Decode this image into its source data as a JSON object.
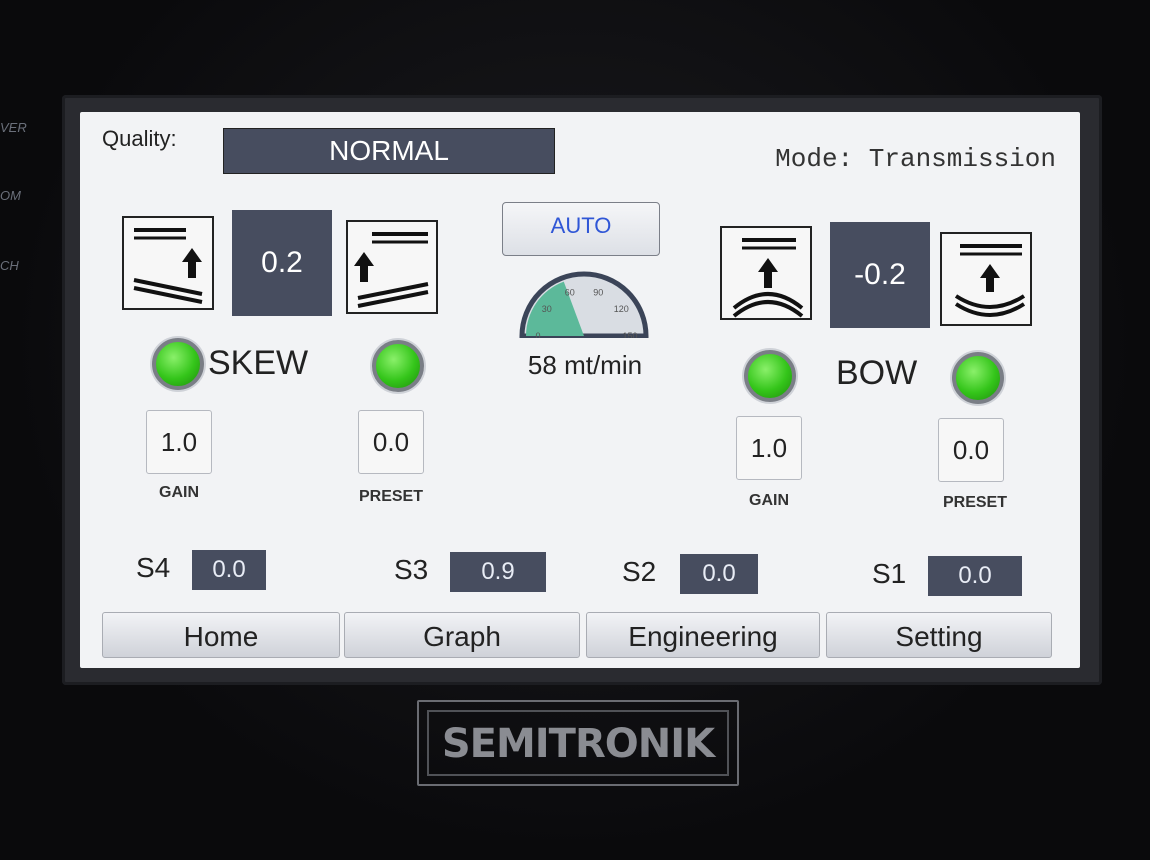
{
  "device": {
    "side_labels": [
      "VER",
      "OM",
      "CH"
    ],
    "brand": "SEMITRONIK"
  },
  "header": {
    "quality_label": "Quality:",
    "quality_value": "NORMAL",
    "mode_text": "Mode: Transmission"
  },
  "skew": {
    "label": "SKEW",
    "value": "0.2",
    "gain": "1.0",
    "gain_label": "GAIN",
    "preset": "0.0",
    "preset_label": "PRESET",
    "left_icon": "skew-left-arrow-icon",
    "right_icon": "skew-right-arrow-icon"
  },
  "center": {
    "mode_button": "AUTO",
    "speed_text": "58 mt/min",
    "gauge_ticks": [
      "0",
      "30",
      "60",
      "90",
      "120",
      "150"
    ],
    "gauge_value": 58,
    "gauge_max": 150
  },
  "bow": {
    "label": "BOW",
    "value": "-0.2",
    "gain": "1.0",
    "gain_label": "GAIN",
    "preset": "0.0",
    "preset_label": "PRESET",
    "left_icon": "bow-convex-arrow-icon",
    "right_icon": "bow-concave-arrow-icon"
  },
  "sensors": [
    {
      "label": "S4",
      "value": "0.0"
    },
    {
      "label": "S3",
      "value": "0.9"
    },
    {
      "label": "S2",
      "value": "0.0"
    },
    {
      "label": "S1",
      "value": "0.0"
    }
  ],
  "tabs": [
    "Home",
    "Graph",
    "Engineering",
    "Setting"
  ],
  "colors": {
    "dark_box": "#474d5f",
    "led_green": "#34c51a",
    "auto_text": "#2f56d6"
  }
}
